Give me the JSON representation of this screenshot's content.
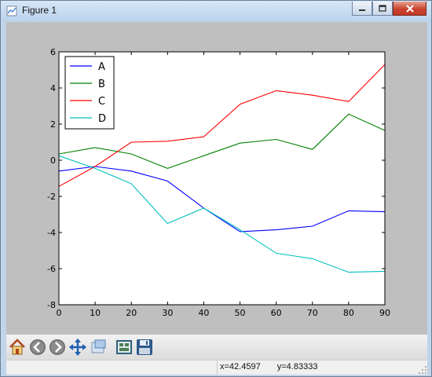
{
  "window": {
    "title": "Figure 1"
  },
  "chart_data": {
    "type": "line",
    "x": [
      0,
      10,
      20,
      30,
      40,
      50,
      60,
      70,
      80,
      90
    ],
    "xlim": [
      0,
      90
    ],
    "ylim": [
      -8,
      6
    ],
    "xticks": [
      0,
      10,
      20,
      30,
      40,
      50,
      60,
      70,
      80,
      90
    ],
    "yticks": [
      -8,
      -6,
      -4,
      -2,
      0,
      2,
      4,
      6
    ],
    "grid": false,
    "legend_position": "top-left",
    "series": [
      {
        "name": "A",
        "color": "#0000ff",
        "values": [
          -0.6,
          -0.35,
          -0.6,
          -1.15,
          -2.65,
          -3.95,
          -3.85,
          -3.65,
          -2.8,
          -2.85
        ]
      },
      {
        "name": "B",
        "color": "#008000",
        "values": [
          0.35,
          0.7,
          0.35,
          -0.45,
          0.25,
          0.95,
          1.15,
          0.6,
          2.55,
          1.65
        ]
      },
      {
        "name": "C",
        "color": "#ff0000",
        "values": [
          -1.45,
          -0.35,
          1.0,
          1.05,
          1.3,
          3.1,
          3.85,
          3.6,
          3.25,
          5.3
        ]
      },
      {
        "name": "D",
        "color": "#00bfbf",
        "values": [
          0.25,
          -0.45,
          -1.3,
          -3.5,
          -2.65,
          -3.85,
          -5.15,
          -5.45,
          -6.2,
          -6.15
        ]
      }
    ]
  },
  "toolbar": {
    "tools": [
      {
        "name": "home-icon",
        "tooltip": ""
      },
      {
        "name": "back-icon",
        "tooltip": ""
      },
      {
        "name": "forward-icon",
        "tooltip": ""
      },
      {
        "name": "pan-icon",
        "tooltip": ""
      },
      {
        "name": "zoom-icon",
        "tooltip": ""
      },
      {
        "name": "subplots-icon",
        "tooltip": ""
      },
      {
        "name": "save-icon",
        "tooltip": ""
      }
    ]
  },
  "status": {
    "x_readout": "x=42.4597",
    "y_readout": "y=4.83333"
  }
}
